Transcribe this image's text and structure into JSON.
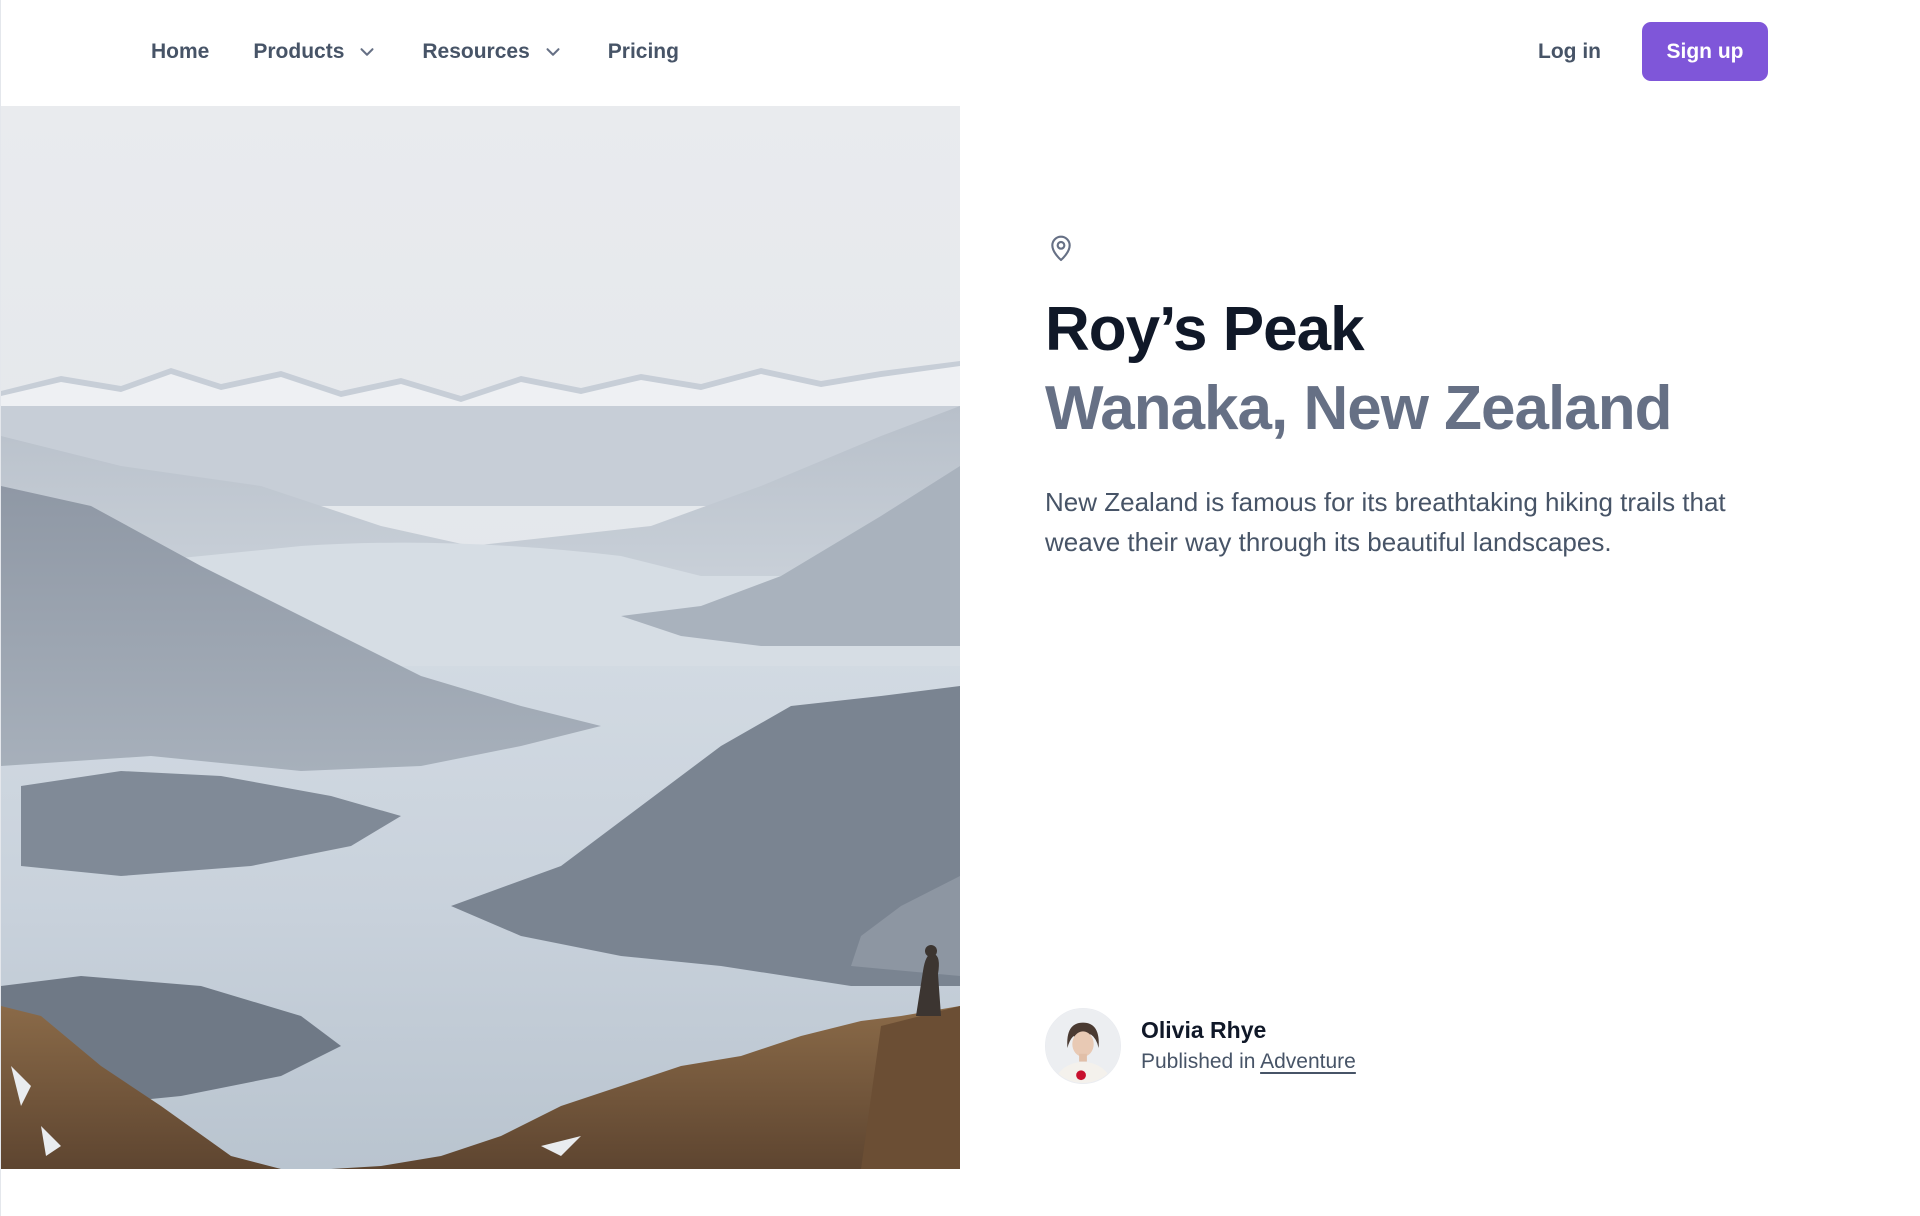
{
  "nav": {
    "links": [
      {
        "label": "Home",
        "has_dropdown": false
      },
      {
        "label": "Products",
        "has_dropdown": true
      },
      {
        "label": "Resources",
        "has_dropdown": true
      },
      {
        "label": "Pricing",
        "has_dropdown": false
      }
    ],
    "login_label": "Log in",
    "signup_label": "Sign up"
  },
  "hero": {
    "image_icon": "landscape-photo",
    "location_icon": "map-pin-icon",
    "title": "Roy’s Peak",
    "subtitle": "Wanaka, New Zealand",
    "description": "New Zealand is famous for its breathtaking hiking trails that weave their way through its beautiful landscapes."
  },
  "author": {
    "name": "Olivia Rhye",
    "published_prefix": "Published in",
    "category": "Adventure"
  },
  "colors": {
    "accent": "#7f56d9",
    "title": "#101828",
    "subtitle": "#667085",
    "body": "#475467"
  }
}
